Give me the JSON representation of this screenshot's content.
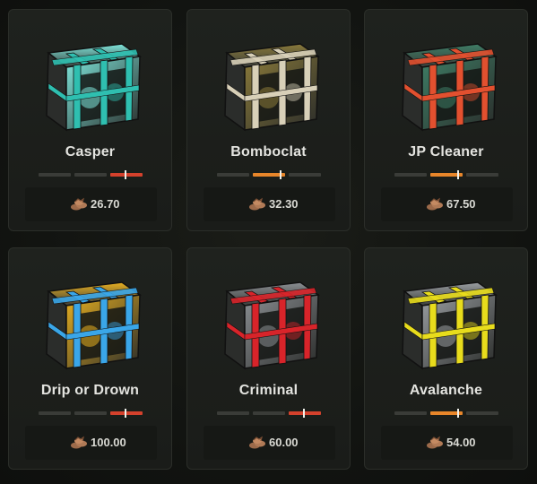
{
  "colors": {
    "bar_idle": "#3a3c38",
    "bar_red": "#d4412c",
    "bar_orange": "#e8862a",
    "tick": "#f0f0ea",
    "card_bg": "#1c1e1b",
    "text": "#e4e4e0"
  },
  "currency_icon": "coin-pile-icon",
  "cases": [
    {
      "name": "Casper",
      "price": "26.70",
      "risk_level": "high",
      "risk_bars": [
        0,
        0,
        1
      ],
      "accent": "#2fbfb0",
      "accent2": "#7fe7dc"
    },
    {
      "name": "Bomboclat",
      "price": "32.30",
      "risk_level": "medium",
      "risk_bars": [
        0,
        1,
        0
      ],
      "accent": "#d8d0b8",
      "accent2": "#8a7a3a"
    },
    {
      "name": "JP Cleaner",
      "price": "67.50",
      "risk_level": "medium",
      "risk_bars": [
        0,
        1,
        0
      ],
      "accent": "#e2502f",
      "accent2": "#3e7e66"
    },
    {
      "name": "Drip or Drown",
      "price": "100.00",
      "risk_level": "high",
      "risk_bars": [
        0,
        0,
        1
      ],
      "accent": "#3aa6e8",
      "accent2": "#e8b020"
    },
    {
      "name": "Criminal",
      "price": "60.00",
      "risk_level": "high",
      "risk_bars": [
        0,
        0,
        1
      ],
      "accent": "#d8242a",
      "accent2": "#8b8f93"
    },
    {
      "name": "Avalanche",
      "price": "54.00",
      "risk_level": "medium",
      "risk_bars": [
        0,
        1,
        0
      ],
      "accent": "#e8dc1c",
      "accent2": "#9a9ea2"
    }
  ]
}
